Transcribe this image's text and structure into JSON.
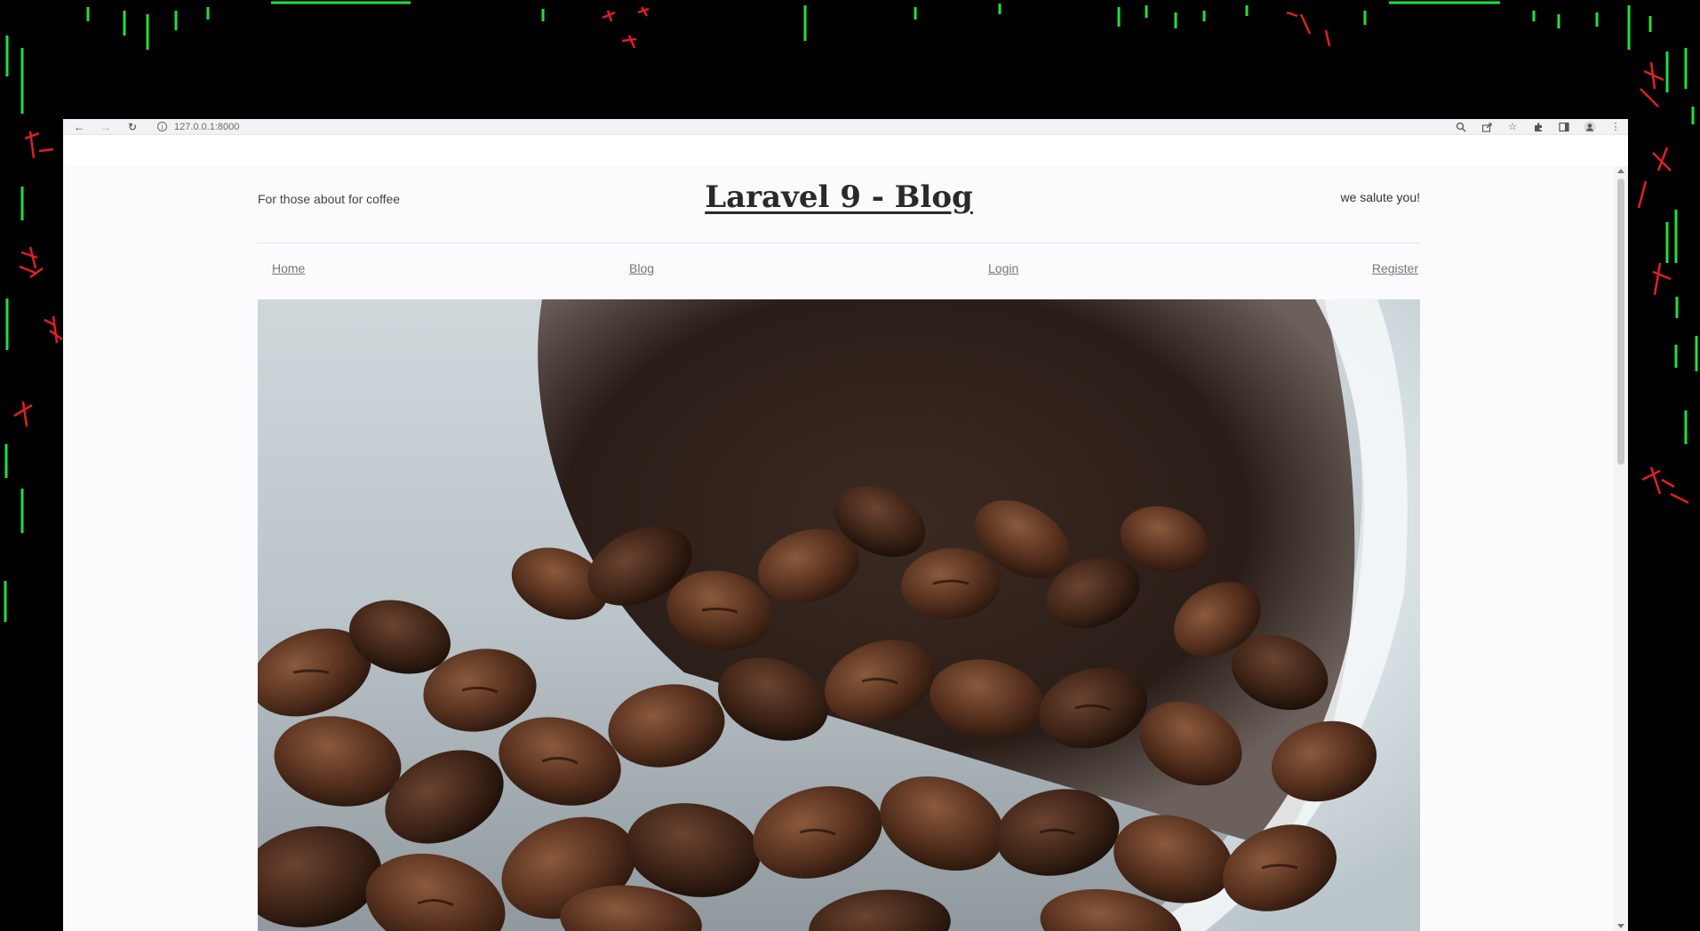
{
  "browser": {
    "url": "127.0.0.1:8000",
    "toolbar_icons": [
      "zoom-icon",
      "share-icon",
      "star-icon",
      "extensions-icon",
      "side-panel-icon",
      "profile-icon",
      "menu-icon"
    ]
  },
  "site": {
    "tagline": "For those about for coffee",
    "title": "Laravel 9 - Blog",
    "salute": "we salute you!"
  },
  "nav": {
    "items": [
      {
        "label": "Home"
      },
      {
        "label": "Blog"
      },
      {
        "label": "Login"
      },
      {
        "label": "Register"
      }
    ]
  },
  "hero": {
    "subject": "coffee beans spilling from white cup"
  },
  "colors": {
    "matrix_green": "#22e03a",
    "matrix_red": "#e02020",
    "page_bg": "#fbfafd"
  }
}
